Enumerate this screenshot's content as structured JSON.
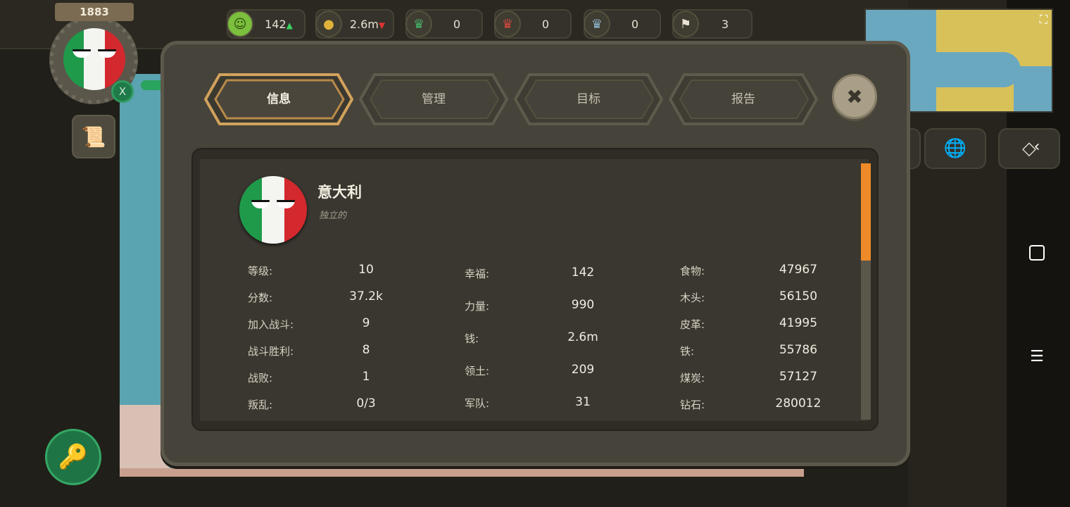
{
  "year": "1883",
  "resources": [
    {
      "icon": "happiness-icon",
      "value": "142",
      "trend": "up"
    },
    {
      "icon": "gold-coins-icon",
      "value": "2.6m",
      "trend": "down"
    },
    {
      "icon": "green-crown-icon",
      "value": "0"
    },
    {
      "icon": "red-crown-icon",
      "value": "0"
    },
    {
      "icon": "blue-crown-icon",
      "value": "0"
    },
    {
      "icon": "alliance-flag-icon",
      "value": "3"
    }
  ],
  "badge": "X",
  "tabs": [
    {
      "label": "信息",
      "active": true
    },
    {
      "label": "管理",
      "active": false
    },
    {
      "label": "目标",
      "active": false
    },
    {
      "label": "报告",
      "active": false
    }
  ],
  "country": {
    "name": "意大利",
    "status": "独立的"
  },
  "stats_col1": [
    {
      "label": "等级:",
      "value": "10"
    },
    {
      "label": "分数:",
      "value": "37.2k"
    },
    {
      "label": "加入战斗:",
      "value": "9"
    },
    {
      "label": "战斗胜利:",
      "value": "8"
    },
    {
      "label": "战败:",
      "value": "1"
    },
    {
      "label": "叛乱:",
      "value": "0/3"
    }
  ],
  "stats_col2": [
    {
      "label": "幸福:",
      "value": "142"
    },
    {
      "label": "力量:",
      "value": "990"
    },
    {
      "label": "钱:",
      "value": "2.6m"
    },
    {
      "label": "领土:",
      "value": "209"
    },
    {
      "label": "军队:",
      "value": "31"
    }
  ],
  "stats_col3": [
    {
      "label": "食物:",
      "value": "47967"
    },
    {
      "label": "木头:",
      "value": "56150"
    },
    {
      "label": "皮革:",
      "value": "41995"
    },
    {
      "label": "铁:",
      "value": "55786"
    },
    {
      "label": "煤炭:",
      "value": "57127"
    },
    {
      "label": "钻石:",
      "value": "280012"
    }
  ],
  "colors": {
    "accent_orange": "#ef8a28",
    "flag_green": "#1f9a4b",
    "flag_red": "#d3282e",
    "active_tab_border": "#d2a25c"
  }
}
